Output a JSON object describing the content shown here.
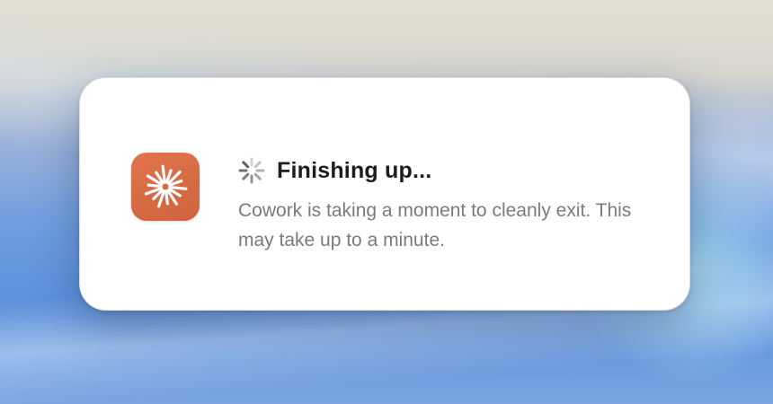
{
  "dialog": {
    "title": "Finishing up...",
    "message": "Cowork is taking a moment to cleanly exit. This may take up to a minute.",
    "app_icon": "sparkle-burst-icon",
    "spinner_icon": "loading-spinner-icon"
  },
  "colors": {
    "app_icon_background": "#d96c45",
    "title_text": "#1d1d1f",
    "message_text": "#7b7b7f",
    "dialog_background": "#ffffff"
  }
}
